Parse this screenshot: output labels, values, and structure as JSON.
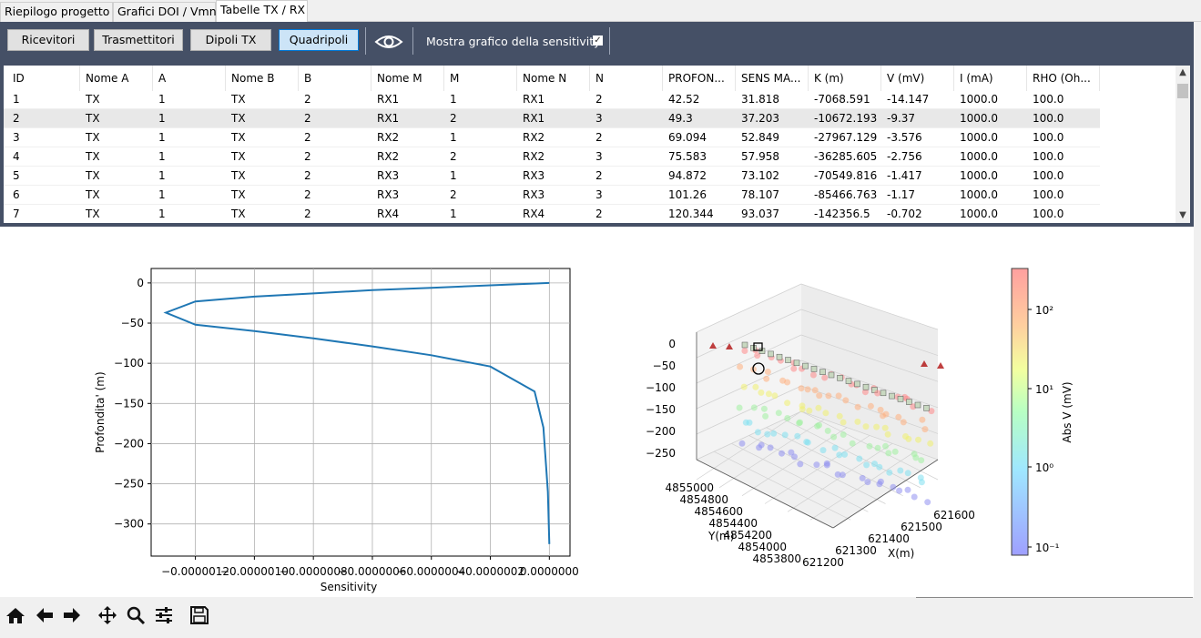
{
  "tabs": [
    "Riepilogo progetto",
    "Grafici DOI / Vmn",
    "Tabelle TX / RX"
  ],
  "toolbar": {
    "buttons": [
      "Ricevitori",
      "Trasmettitori",
      "Dipoli TX",
      "Quadripoli"
    ],
    "active_button": "Quadripoli",
    "eye_icon": "eye-icon",
    "sensitivity_label": "Mostra grafico della sensitivity",
    "sensitivity_checked": true,
    "checkmark": "✓"
  },
  "table": {
    "columns": [
      "ID",
      "Nome A",
      "A",
      "Nome B",
      "B",
      "Nome M",
      "M",
      "Nome N",
      "N",
      "PROFON...",
      "SENS MA...",
      "K (m)",
      "V (mV)",
      "I (mA)",
      "RHO (Oh..."
    ],
    "rows": [
      [
        "1",
        "TX",
        "1",
        "TX",
        "2",
        "RX1",
        "1",
        "RX1",
        "2",
        "42.52",
        "31.818",
        "-7068.591",
        "-14.147",
        "1000.0",
        "100.0"
      ],
      [
        "2",
        "TX",
        "1",
        "TX",
        "2",
        "RX1",
        "2",
        "RX1",
        "3",
        "49.3",
        "37.203",
        "-10672.193",
        "-9.37",
        "1000.0",
        "100.0"
      ],
      [
        "3",
        "TX",
        "1",
        "TX",
        "2",
        "RX2",
        "1",
        "RX2",
        "2",
        "69.094",
        "52.849",
        "-27967.129",
        "-3.576",
        "1000.0",
        "100.0"
      ],
      [
        "4",
        "TX",
        "1",
        "TX",
        "2",
        "RX2",
        "2",
        "RX2",
        "3",
        "75.583",
        "57.958",
        "-36285.605",
        "-2.756",
        "1000.0",
        "100.0"
      ],
      [
        "5",
        "TX",
        "1",
        "TX",
        "2",
        "RX3",
        "1",
        "RX3",
        "2",
        "94.872",
        "73.102",
        "-70549.816",
        "-1.417",
        "1000.0",
        "100.0"
      ],
      [
        "6",
        "TX",
        "1",
        "TX",
        "2",
        "RX3",
        "2",
        "RX3",
        "3",
        "101.26",
        "78.107",
        "-85466.763",
        "-1.17",
        "1000.0",
        "100.0"
      ],
      [
        "7",
        "TX",
        "1",
        "TX",
        "2",
        "RX4",
        "1",
        "RX4",
        "2",
        "120.344",
        "93.037",
        "-142356.5",
        "-0.702",
        "1000.0",
        "100.0"
      ]
    ],
    "selected_row": 2
  },
  "plot_sensitivity": {
    "xlabel": "Sensitivity",
    "ylabel": "Profondita' (m)",
    "y_ticks": [
      "0",
      "−50",
      "−100",
      "−150",
      "−200",
      "−250",
      "−300"
    ],
    "x_ticks": [
      "−0.0000012",
      "−0.0000010",
      "−0.0000008",
      "−0.0000006",
      "−0.0000004",
      "−0.0000002",
      "0.0000000"
    ],
    "line_color": "#1f77b4"
  },
  "plot_3d": {
    "z_ticks": [
      "0",
      "−50",
      "−100",
      "−150",
      "−200",
      "−250"
    ],
    "y_ticks": [
      "4855000",
      "4854800",
      "4854600",
      "4854400",
      "4854200",
      "4854000",
      "4853800"
    ],
    "x_ticks": [
      "621200",
      "621300",
      "621400",
      "621500",
      "621600"
    ],
    "ylabel": "Y(m)",
    "xlabel": "X(m)"
  },
  "colorbar": {
    "label": "Abs V (mV)",
    "ticks": [
      "10²",
      "10¹",
      "10⁰",
      "10⁻¹"
    ]
  },
  "chart_data": [
    {
      "type": "line",
      "xlabel": "Sensitivity",
      "ylabel": "Profondita' (m)",
      "xlim": [
        -1.35e-06,
        7e-08
      ],
      "ylim": [
        -340,
        18
      ],
      "series": [
        {
          "x": [
            0.0,
            -2e-07,
            -4e-07,
            -6e-07,
            -8e-07,
            -1e-06,
            -1.2e-06,
            -1.3e-06,
            -1.2e-06,
            -1e-06,
            -8e-07,
            -6e-07,
            -4e-07,
            -2e-07,
            -5e-08,
            -2e-08,
            -5e-09,
            0.0
          ],
          "y": [
            0,
            -3,
            -6,
            -9,
            -13,
            -17,
            -23,
            -37,
            -52,
            -60,
            -69,
            -79,
            -90,
            -104,
            -135,
            -180,
            -260,
            -325
          ]
        }
      ]
    }
  ],
  "nav_icons": [
    "home-icon",
    "back-icon",
    "forward-icon",
    "pan-icon",
    "zoom-icon",
    "configure-icon",
    "save-icon"
  ]
}
